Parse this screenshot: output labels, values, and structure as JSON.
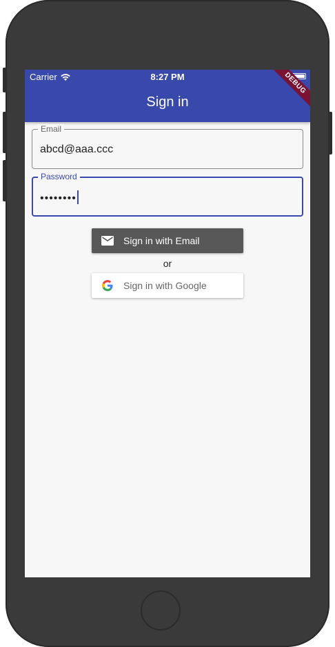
{
  "status_bar": {
    "carrier": "Carrier",
    "time": "8:27 PM"
  },
  "app_bar": {
    "title": "Sign in",
    "debug_banner": "DEBUG",
    "color": "#3949ab"
  },
  "form": {
    "email": {
      "label": "Email",
      "value": "abcd@aaa.ccc"
    },
    "password": {
      "label": "Password",
      "value": "••••••••"
    }
  },
  "buttons": {
    "email_sign_in": "Sign in with Email",
    "or_separator": "or",
    "google_sign_in": "Sign in with Google"
  },
  "icons": {
    "wifi": "wifi-icon",
    "battery": "battery-icon",
    "mail": "mail-icon",
    "google": "google-g-icon"
  }
}
